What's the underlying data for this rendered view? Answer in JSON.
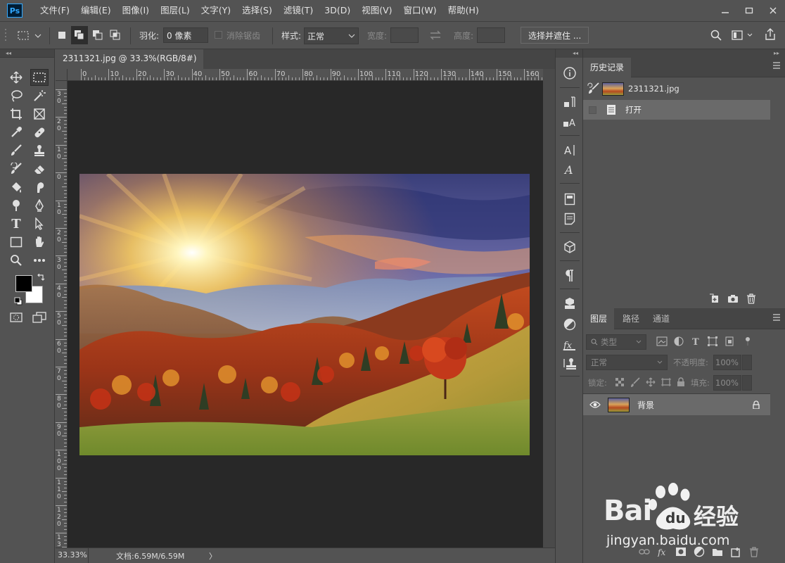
{
  "app": {
    "logo": "Ps"
  },
  "menu": [
    "文件(F)",
    "编辑(E)",
    "图像(I)",
    "图层(L)",
    "文字(Y)",
    "选择(S)",
    "滤镜(T)",
    "3D(D)",
    "视图(V)",
    "窗口(W)",
    "帮助(H)"
  ],
  "options": {
    "feather_label": "羽化:",
    "feather_value": "0 像素",
    "antialias_label": "消除锯齿",
    "style_label": "样式:",
    "style_value": "正常",
    "width_label": "宽度:",
    "height_label": "高度:",
    "select_mask_button": "选择并遮住 ..."
  },
  "document": {
    "tab_title": "2311321.jpg @ 33.3%(RGB/8#)",
    "close": "×",
    "ruler_top": [
      "0",
      "10",
      "20",
      "30",
      "40",
      "50",
      "60",
      "70",
      "80",
      "90",
      "100",
      "110",
      "120",
      "130",
      "140",
      "150",
      "160"
    ],
    "ruler_left": [
      "3\n0",
      "2\n0",
      "1\n0",
      "0",
      "1\n0",
      "2\n0",
      "3\n0",
      "4\n0",
      "5\n0",
      "6\n0",
      "7\n0",
      "8\n0",
      "9\n0",
      "1\n0\n0",
      "1\n1\n0",
      "1\n2\n0",
      "1\n3\n0"
    ],
    "image_description_alt": "mountain-sunrise-autumn"
  },
  "status": {
    "zoom": "33.33%",
    "doc_info": "文档:6.59M/6.59M",
    "arrow": "〉"
  },
  "history_panel": {
    "tab": "历史记录",
    "snapshot_name": "2311321.jpg",
    "steps": [
      "打开"
    ]
  },
  "layers_panel": {
    "tabs": [
      "图层",
      "路径",
      "通道"
    ],
    "filter_kind": "类型",
    "blend_mode": "正常",
    "opacity_label": "不透明度:",
    "opacity_value": "100%",
    "lock_label": "锁定:",
    "fill_label": "填充:",
    "fill_value": "100%",
    "layers": [
      {
        "name": "背景",
        "locked": true,
        "visible": true
      }
    ]
  },
  "watermark": {
    "brand": "Bai",
    "brand2": "du",
    "cn": "经验",
    "url": "jingyan.baidu.com"
  },
  "colors": {
    "foreground": "#000000",
    "background": "#ffffff",
    "accent": "#31a8ff"
  }
}
